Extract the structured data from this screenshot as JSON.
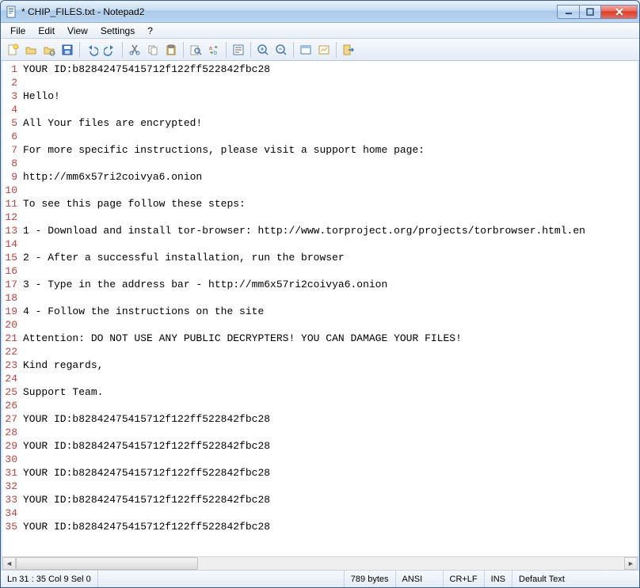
{
  "window": {
    "title": "* CHIP_FILES.txt - Notepad2"
  },
  "menu": {
    "file": "File",
    "edit": "Edit",
    "view": "View",
    "settings": "Settings",
    "help": "?"
  },
  "lines": [
    "YOUR ID:b82842475415712f122ff522842fbc28",
    "",
    "Hello!",
    "",
    "All Your files are encrypted!",
    "",
    "For more specific instructions, please visit a support home page:",
    "",
    "http://mm6x57ri2coivya6.onion",
    "",
    "To see this page follow these steps:",
    "",
    "1 - Download and install tor-browser: http://www.torproject.org/projects/torbrowser.html.en",
    "",
    "2 - After a successful installation, run the browser",
    "",
    "3 - Type in the address bar - http://mm6x57ri2coivya6.onion",
    "",
    "4 - Follow the instructions on the site",
    "",
    "Attention: DO NOT USE ANY PUBLIC DECRYPTERS! YOU CAN DAMAGE YOUR FILES!",
    "",
    "Kind regards,",
    "",
    "Support Team.",
    "",
    "YOUR ID:b82842475415712f122ff522842fbc28",
    "",
    "YOUR ID:b82842475415712f122ff522842fbc28",
    "",
    "YOUR ID:b82842475415712f122ff522842fbc28",
    "",
    "YOUR ID:b82842475415712f122ff522842fbc28",
    "",
    "YOUR ID:b82842475415712f122ff522842fbc28"
  ],
  "status": {
    "pos": "Ln 31 : 35   Col 9   Sel 0",
    "bytes": "789 bytes",
    "encoding": "ANSI",
    "eol": "CR+LF",
    "mode": "INS",
    "type": "Default Text"
  }
}
